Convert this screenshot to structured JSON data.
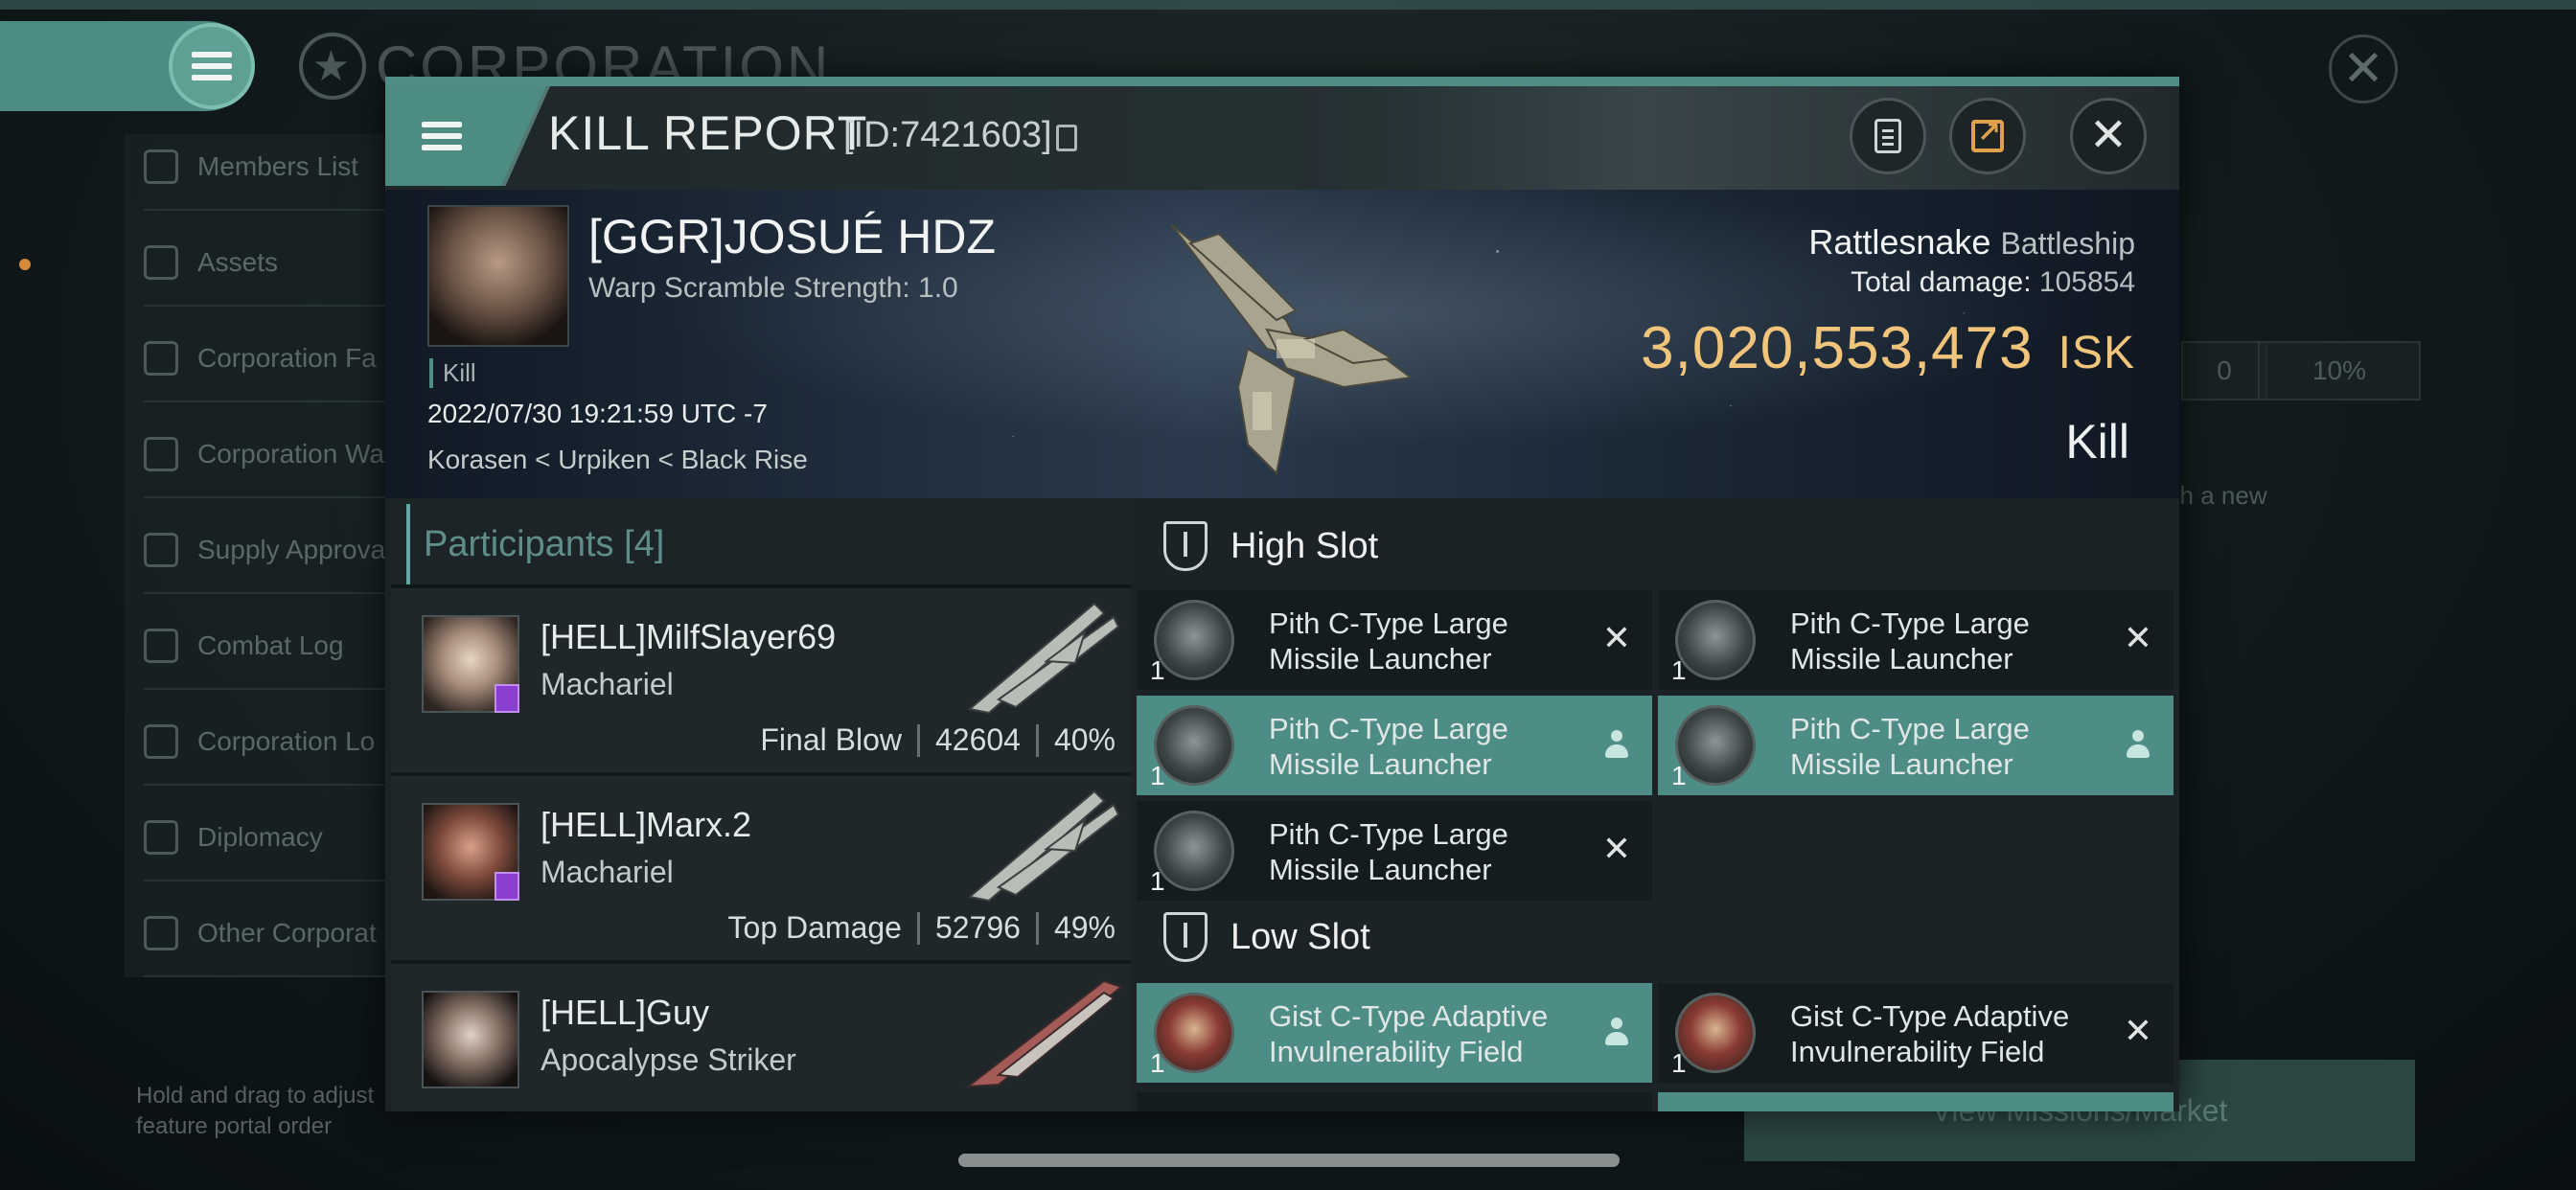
{
  "background": {
    "corporation_title": "CORPORATION",
    "sidebar_items": [
      {
        "label": "Members List",
        "icon": "members-icon"
      },
      {
        "label": "Assets",
        "icon": "assets-icon"
      },
      {
        "label": "Corporation Fa",
        "icon": "facilities-icon"
      },
      {
        "label": "Corporation Wa",
        "icon": "wallet-icon"
      },
      {
        "label": "Supply Approva",
        "icon": "supply-icon"
      },
      {
        "label": "Combat Log",
        "icon": "combat-log-icon"
      },
      {
        "label": "Corporation Lo",
        "icon": "corp-log-icon"
      },
      {
        "label": "Diplomacy",
        "icon": "diplomacy-icon"
      },
      {
        "label": "Other Corporat",
        "icon": "other-corp-icon"
      }
    ],
    "hint_line1": "Hold and drag to adjust",
    "hint_line2": "feature portal order",
    "right_value1": "0",
    "right_value2": "10%",
    "right_text": "lish a new",
    "missions_button": "View Missions/Market"
  },
  "dialog": {
    "title": "KILL REPORT",
    "id_text": "[ID:7421603]",
    "victim": {
      "name": "[GGR]JOSUÉ HDZ",
      "warp": "Warp Scramble Strength: 1.0",
      "tag": "Kill",
      "datetime": "2022/07/30 19:21:59 UTC -7",
      "location": "Korasen < Urpiken < Black Rise",
      "ship": "Rattlesnake",
      "ship_class": "Battleship",
      "total_damage_label": "Total damage:",
      "total_damage": "105854",
      "isk_value": "3,020,553,473",
      "isk_unit": "ISK",
      "result": "Kill"
    },
    "participants": {
      "label": "Participants",
      "count": "[4]",
      "rows": [
        {
          "name": "[HELL]MilfSlayer69",
          "ship": "Machariel",
          "role": "Final Blow",
          "damage": "42604",
          "percent": "40%"
        },
        {
          "name": "[HELL]Marx.2",
          "ship": "Machariel",
          "role": "Top Damage",
          "damage": "52796",
          "percent": "49%"
        },
        {
          "name": "[HELL]Guy",
          "ship": "Apocalypse Striker",
          "role": "",
          "damage": "",
          "percent": ""
        }
      ]
    },
    "high_slot": {
      "label": "High Slot",
      "modules": [
        {
          "name": "Pith C-Type Large Missile Launcher",
          "qty": "1",
          "state": "destroyed"
        },
        {
          "name": "Pith C-Type Large Missile Launcher",
          "qty": "1",
          "state": "destroyed"
        },
        {
          "name": "Pith C-Type Large Missile Launcher",
          "qty": "1",
          "state": "dropped"
        },
        {
          "name": "Pith C-Type Large Missile Launcher",
          "qty": "1",
          "state": "dropped"
        },
        {
          "name": "Pith C-Type Large Missile Launcher",
          "qty": "1",
          "state": "destroyed"
        }
      ]
    },
    "low_slot": {
      "label": "Low Slot",
      "modules": [
        {
          "name": "Gist C-Type Adaptive Invulnerability Field",
          "qty": "1",
          "state": "dropped"
        },
        {
          "name": "Gist C-Type Adaptive Invulnerability Field",
          "qty": "1",
          "state": "destroyed"
        }
      ]
    }
  }
}
